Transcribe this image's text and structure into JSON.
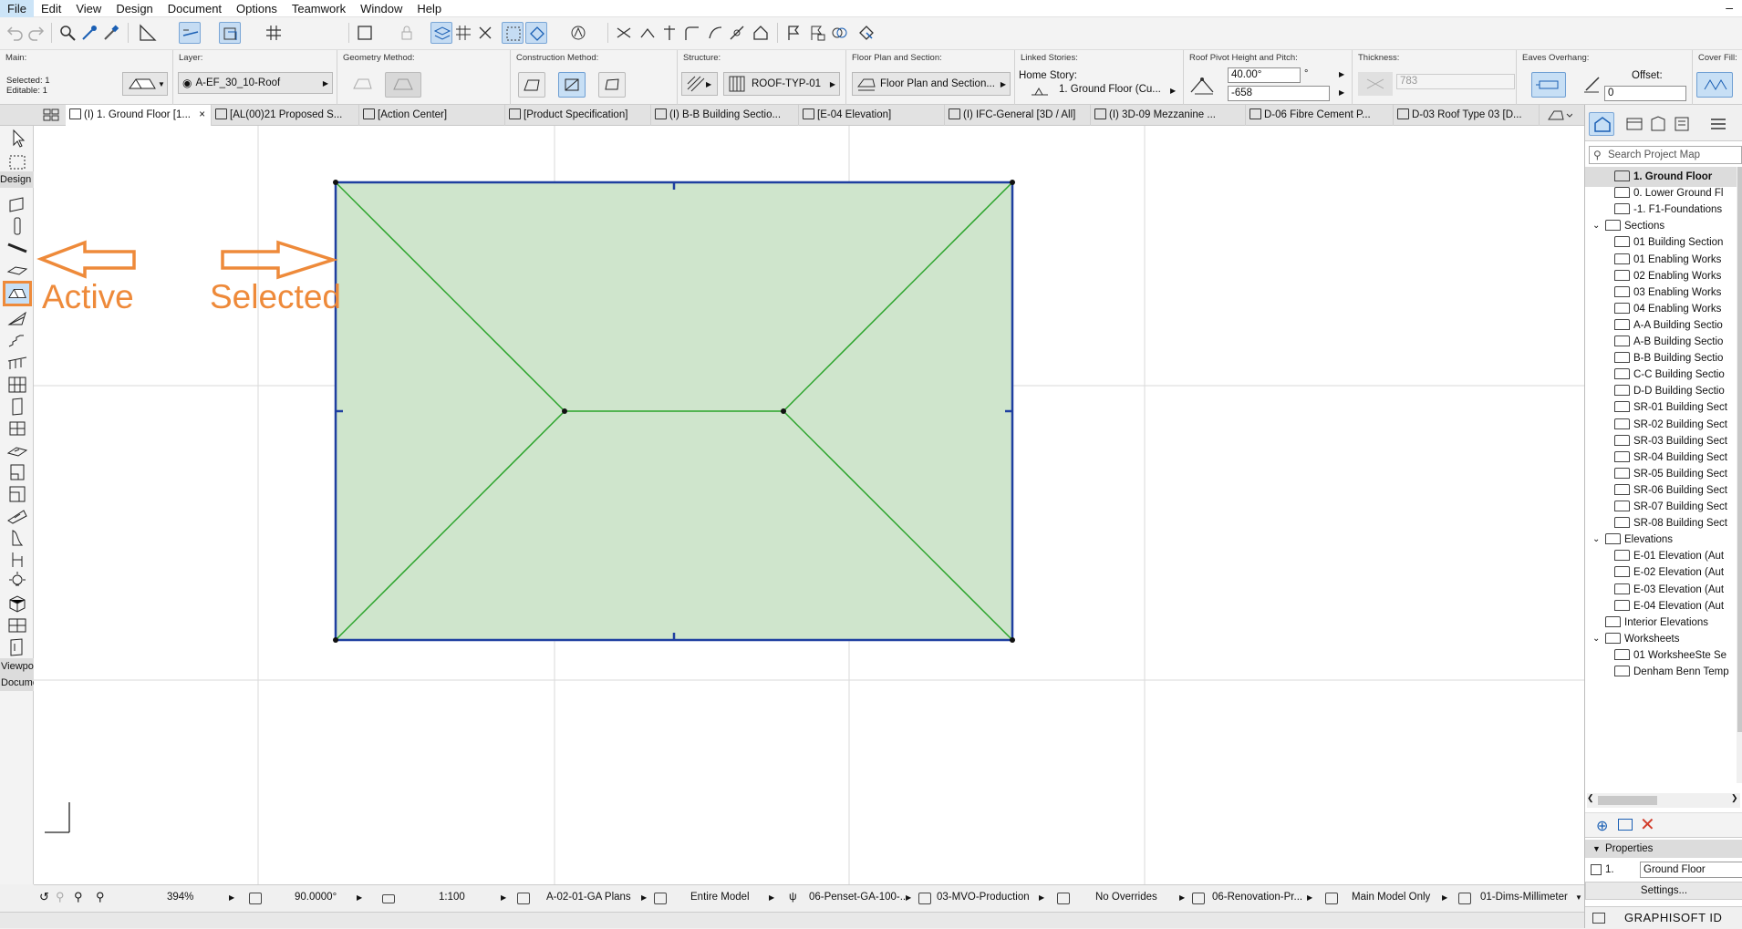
{
  "menu": {
    "items": [
      "File",
      "Edit",
      "View",
      "Design",
      "Document",
      "Options",
      "Teamwork",
      "Window",
      "Help"
    ],
    "minimize_glyph": "–"
  },
  "infobox": {
    "main": {
      "title": "Main:",
      "selected": "Selected: 1",
      "editable": "Editable: 1"
    },
    "layer": {
      "title": "Layer:",
      "value": "A-EF_30_10-Roof"
    },
    "geometry": {
      "title": "Geometry Method:"
    },
    "construction": {
      "title": "Construction Method:"
    },
    "structure": {
      "title": "Structure:",
      "value": "ROOF-TYP-01"
    },
    "floorplan": {
      "title": "Floor Plan and Section:",
      "value": "Floor Plan and Section..."
    },
    "linked": {
      "title": "Linked Stories:",
      "home_label": "Home Story:",
      "home_value": "1. Ground Floor (Cu..."
    },
    "pivot": {
      "title": "Roof Pivot Height and Pitch:",
      "pitch": "40.00°",
      "pitch_unit": "°",
      "height": "-658"
    },
    "thickness": {
      "title": "Thickness:",
      "value": "783"
    },
    "eaves": {
      "title": "Eaves Overhang:",
      "offset_label": "Offset:",
      "offset_value": "0"
    },
    "cover": {
      "title": "Cover Fill:"
    }
  },
  "tabs": [
    {
      "label": "(I) 1. Ground Floor [1...",
      "close": "×"
    },
    {
      "label": "[AL(00)21 Proposed S..."
    },
    {
      "label": "[Action Center]"
    },
    {
      "label": "[Product Specification]"
    },
    {
      "label": "(I) B-B Building Sectio..."
    },
    {
      "label": "[E-04 Elevation]"
    },
    {
      "label": "(I) IFC-General [3D / All]"
    },
    {
      "label": "(I) 3D-09 Mezzanine ..."
    },
    {
      "label": "D-06 Fibre Cement P..."
    },
    {
      "label": "D-03 Roof Type 03 [D..."
    }
  ],
  "toolbox": {
    "design_header": "Design",
    "viewpoint_header": "Viewpoi",
    "document_header": "Docume",
    "tools": [
      "wall-tool",
      "column-tool",
      "beam-tool",
      "slab-tool",
      "roof-tool",
      "shell-tool",
      "stair-tool",
      "railing-tool",
      "curtain-wall-tool",
      "door-tool",
      "window-tool",
      "skylight-tool",
      "wall-end-tool",
      "corner-window-tool",
      "dormer-tool",
      "mesh-tool",
      "morph-tool",
      "object-tool",
      "lamp-tool",
      "zone-tool",
      "grid-tool",
      "opening-tool"
    ]
  },
  "annotations": {
    "active": "Active",
    "selected": "Selected",
    "color": "#ee8a3a"
  },
  "canvas": {
    "roof_fill": "#cfe5cc",
    "roof_edge": "#1f3fa0",
    "ridge": "#2aa32a"
  },
  "statusbar": {
    "zoom": "394%",
    "angle": "90.0000°",
    "scale": "1:100",
    "layer_combo": "A-02-01-GA Plans",
    "model_view": "Entire Model",
    "pen_set": "06-Penset-GA-100-...",
    "mvo": "03-MVO-Production",
    "overrides": "No Overrides",
    "renovation": "06-Renovation-Pr...",
    "model_only": "Main Model Only",
    "dims": "01-Dims-Millimeter"
  },
  "navigator": {
    "search_placeholder": "Search Project Map",
    "items": [
      {
        "label": "1. Ground Floor",
        "level": 2,
        "selected": true
      },
      {
        "label": "0. Lower Ground Fl",
        "level": 2
      },
      {
        "label": "-1. F1-Foundations",
        "level": 2
      },
      {
        "label": "Sections",
        "level": 1,
        "folder": true
      },
      {
        "label": "01 Building Section",
        "level": 2
      },
      {
        "label": "01 Enabling Works",
        "level": 2
      },
      {
        "label": "02 Enabling Works",
        "level": 2
      },
      {
        "label": "03 Enabling Works",
        "level": 2
      },
      {
        "label": "04 Enabling Works",
        "level": 2
      },
      {
        "label": "A-A Building Sectio",
        "level": 2
      },
      {
        "label": "A-B Building Sectio",
        "level": 2
      },
      {
        "label": "B-B Building Sectio",
        "level": 2
      },
      {
        "label": "C-C Building Sectio",
        "level": 2
      },
      {
        "label": "D-D Building Sectio",
        "level": 2
      },
      {
        "label": "SR-01 Building Sect",
        "level": 2
      },
      {
        "label": "SR-02 Building Sect",
        "level": 2
      },
      {
        "label": "SR-03 Building Sect",
        "level": 2
      },
      {
        "label": "SR-04 Building Sect",
        "level": 2
      },
      {
        "label": "SR-05 Building Sect",
        "level": 2
      },
      {
        "label": "SR-06 Building Sect",
        "level": 2
      },
      {
        "label": "SR-07 Building Sect",
        "level": 2
      },
      {
        "label": "SR-08 Building Sect",
        "level": 2
      },
      {
        "label": "Elevations",
        "level": 1,
        "folder": true
      },
      {
        "label": "E-01 Elevation (Aut",
        "level": 2
      },
      {
        "label": "E-02 Elevation (Aut",
        "level": 2
      },
      {
        "label": "E-03 Elevation (Aut",
        "level": 2
      },
      {
        "label": "E-04 Elevation (Aut",
        "level": 2
      },
      {
        "label": "Interior Elevations",
        "level": 1
      },
      {
        "label": "Worksheets",
        "level": 1,
        "folder": true
      },
      {
        "label": "01 WorksheeSte Se",
        "level": 2
      },
      {
        "label": "Denham Benn Temp",
        "level": 2
      }
    ],
    "properties_label": "Properties",
    "prop_id": "1.",
    "prop_value": "Ground Floor",
    "settings_label": "Settings...",
    "graphisoft_id": "GRAPHISOFT ID"
  }
}
